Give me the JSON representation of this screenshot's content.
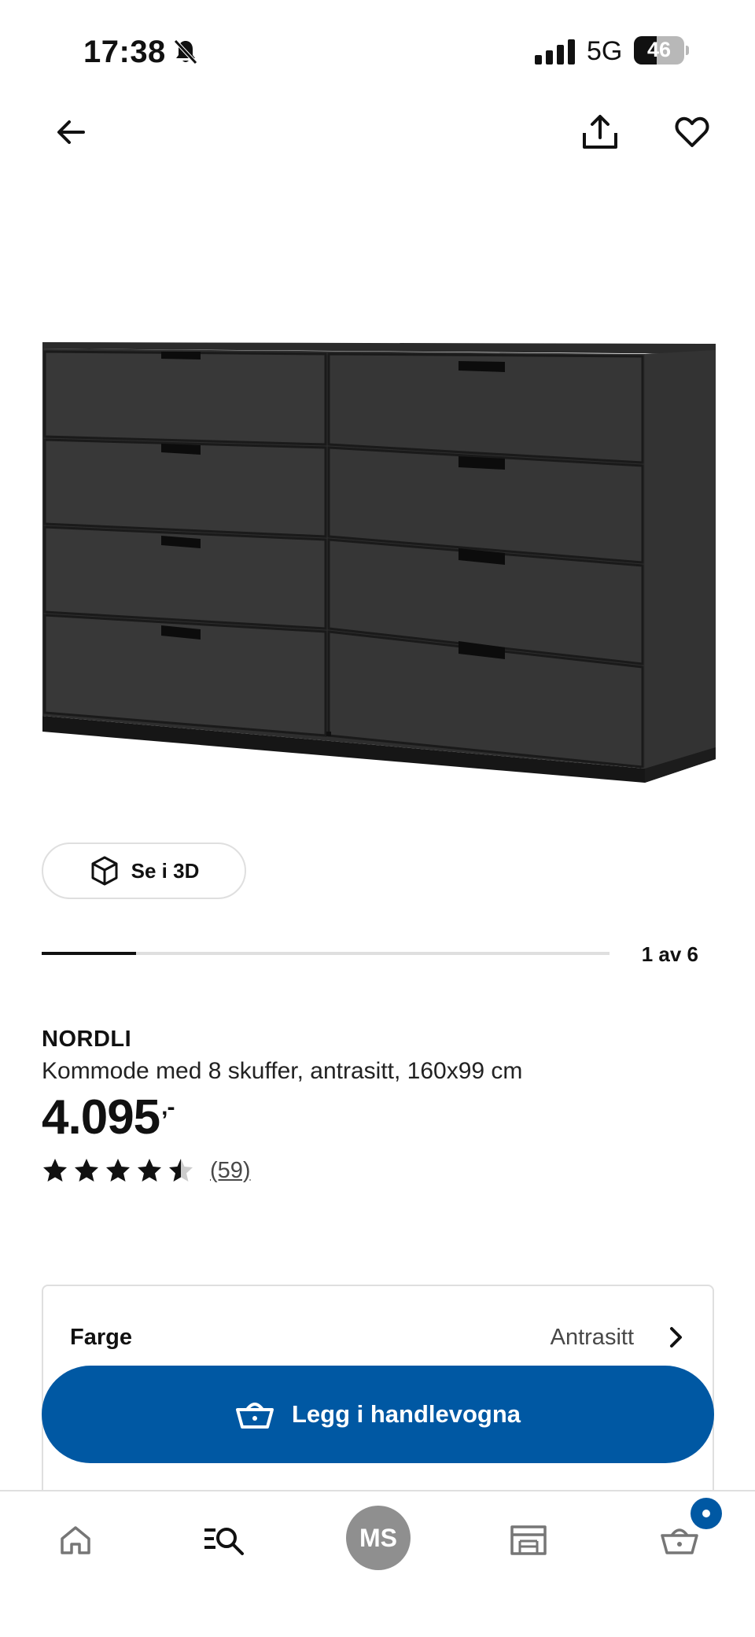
{
  "status_bar": {
    "time": "17:38",
    "network": "5G",
    "battery": "46",
    "battery_level": 0.46
  },
  "header": {
    "back_icon": "arrow-left-icon",
    "share_icon": "share-icon",
    "favorite_icon": "heart-icon"
  },
  "gallery": {
    "view_3d_label": "Se i 3D",
    "counter": "1 av 6",
    "progress": 0.1667
  },
  "product": {
    "name": "NORDLI",
    "description": "Kommode med 8 skuffer, antrasitt, 160x99 cm",
    "price": "4.095",
    "price_suffix": ",-",
    "rating": 4.5,
    "rating_max": 5,
    "review_count": "(59)"
  },
  "options": {
    "color_label": "Farge",
    "color_value": "Antrasitt"
  },
  "cta": {
    "add_to_cart_label": "Legg i handlevogna",
    "color": "#0058a3"
  },
  "bottom_nav": {
    "profile_initials": "MS",
    "items": [
      "home-icon",
      "search-list-icon",
      "profile-avatar",
      "store-icon",
      "cart-icon"
    ]
  }
}
